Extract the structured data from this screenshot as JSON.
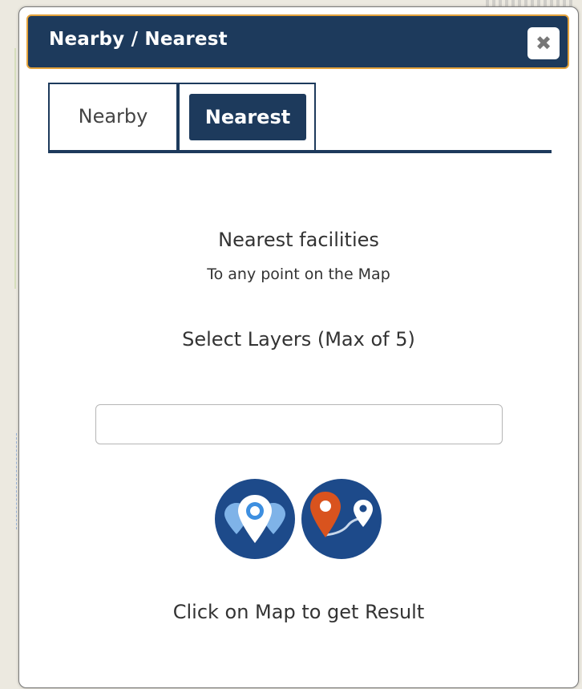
{
  "panel": {
    "title": "Nearby / Nearest",
    "close_icon": "close-icon"
  },
  "tabs": [
    {
      "label": "Nearby",
      "active": false
    },
    {
      "label": "Nearest",
      "active": true
    }
  ],
  "content": {
    "heading": "Nearest facilities",
    "subheading": "To any point on the Map",
    "select_label": "Select Layers (Max of 5)",
    "layer_input_value": "",
    "hint": "Click on Map to get Result"
  },
  "icons": {
    "nearby": "nearby-pins-icon",
    "nearest": "nearest-route-icon"
  },
  "colors": {
    "header_bg": "#1d3a5c",
    "header_border": "#e3a23b",
    "icon_circle": "#1d4a8a",
    "pin_orange": "#d9531e",
    "pin_blue": "#3d8fe0"
  }
}
